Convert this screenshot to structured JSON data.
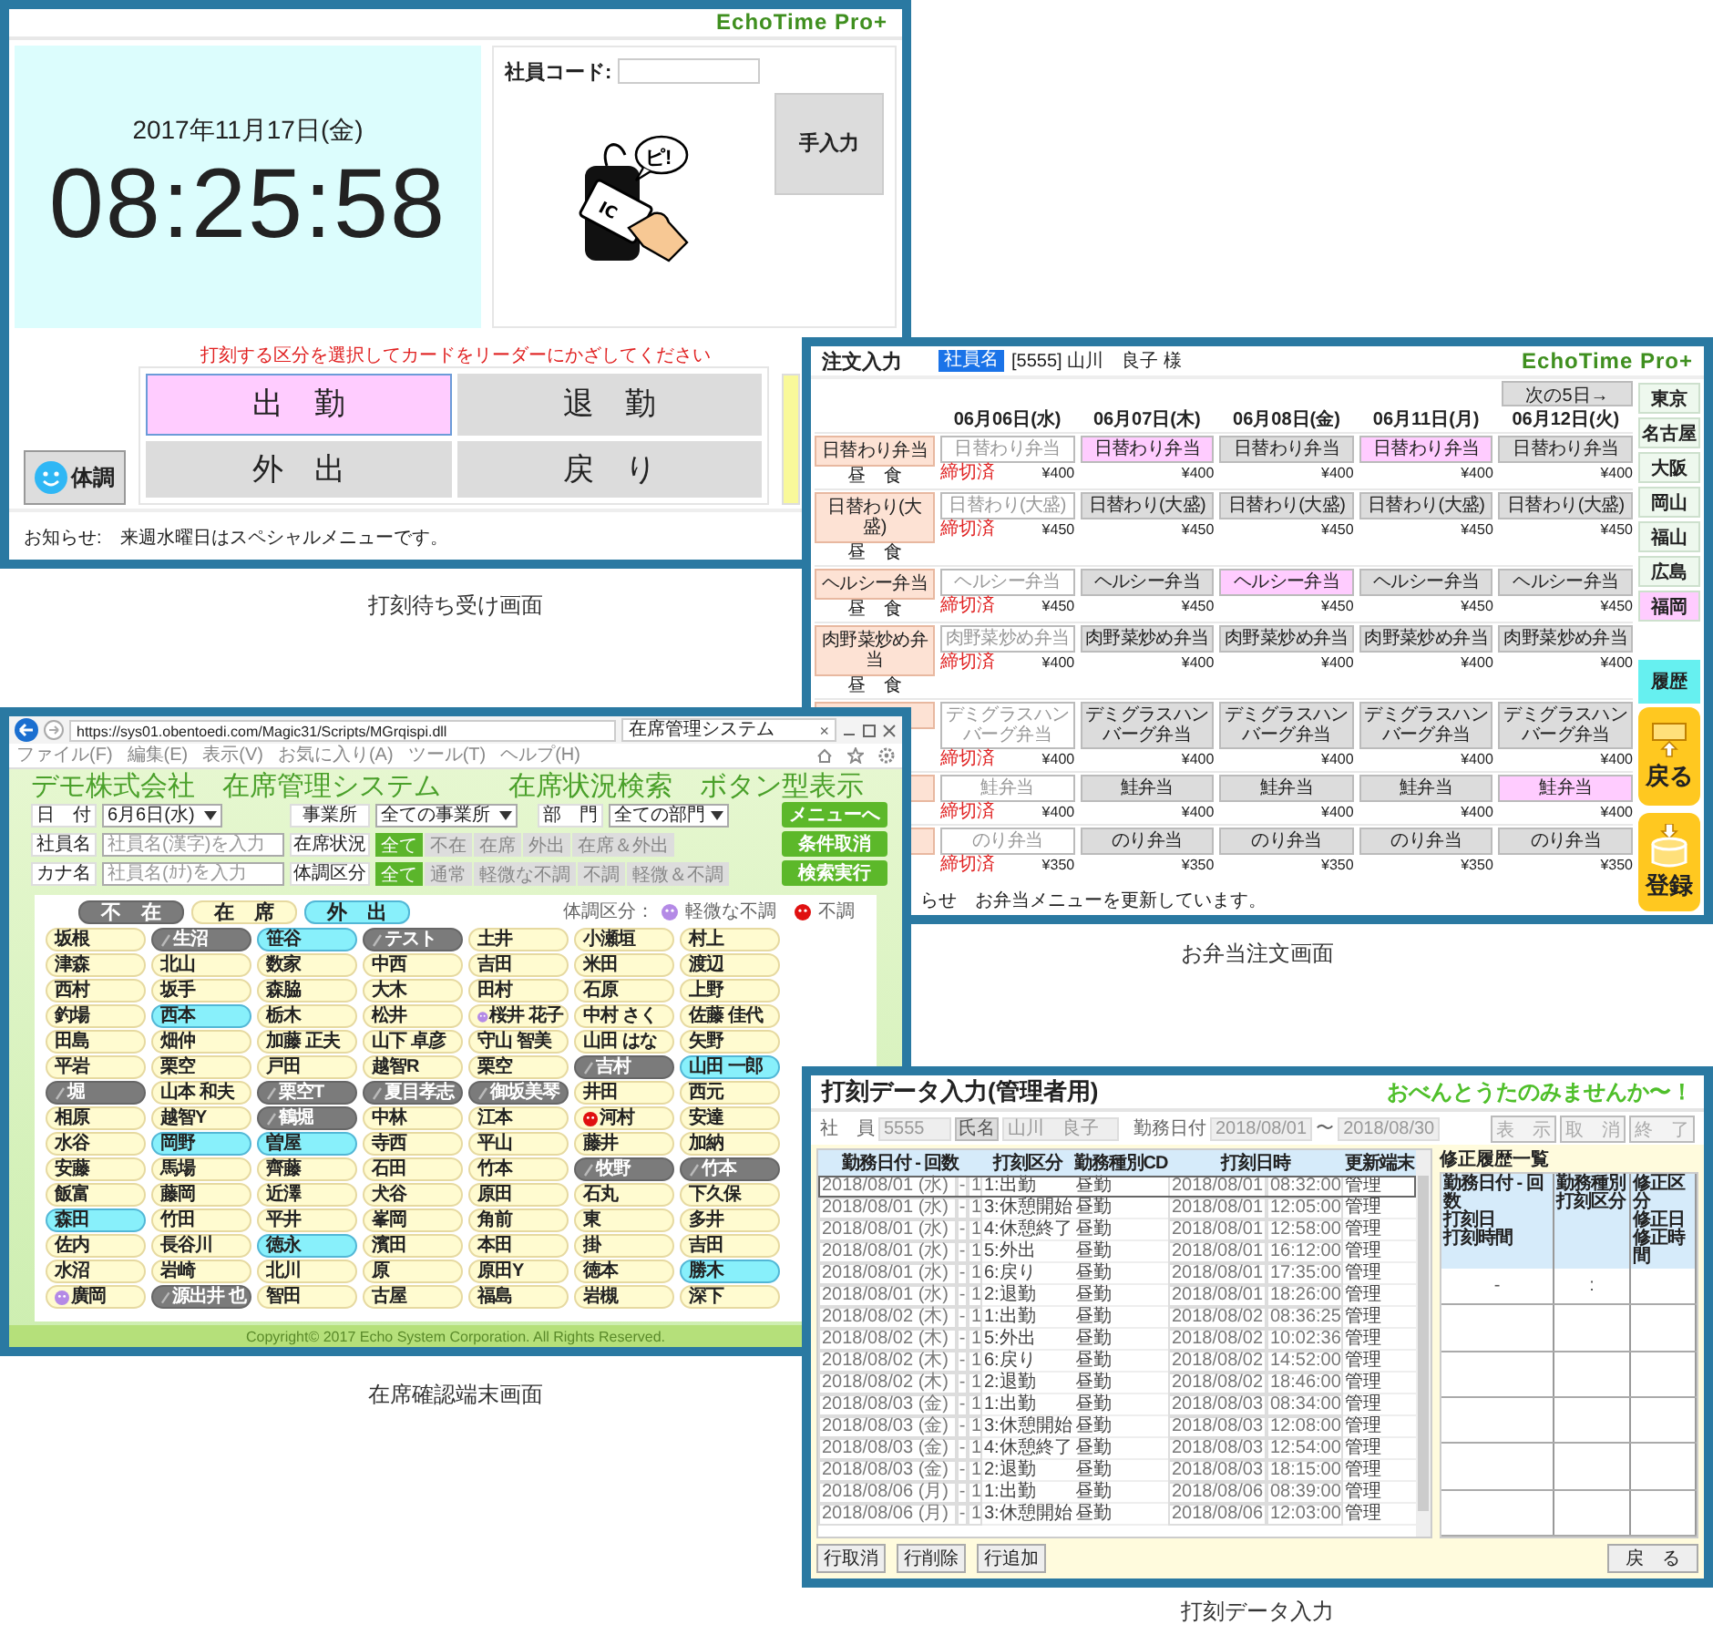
{
  "clock_screen": {
    "logo": "EchoTime Pro+",
    "date": "2017年11月17日(金)",
    "time": "08:25:58",
    "code_label": "社員コード:",
    "card_text": "IC",
    "bubble_text": "ピ!",
    "manual_button": "手入力",
    "instruction": "打刻する区分を選択してカードをリーダーにかざしてください",
    "punch_buttons": [
      {
        "label": "出　勤",
        "selected": true
      },
      {
        "label": "退　勤",
        "selected": false
      },
      {
        "label": "外　出",
        "selected": false
      },
      {
        "label": "戻　り",
        "selected": false
      }
    ],
    "health_button": "体調",
    "notice": "お知らせ:　来週水曜日はスペシャルメニューです。",
    "caption": "打刻待ち受け画面"
  },
  "order_screen": {
    "title": "注文入力",
    "user_badge": "社員名",
    "user_name": "[5555] 山川　良子 様",
    "logo": "EchoTime Pro+",
    "next_button": "次の5日→",
    "dates": [
      "06月06日(水)",
      "06月07日(木)",
      "06月08日(金)",
      "06月11日(月)",
      "06月12日(火)"
    ],
    "menus": [
      {
        "label": "日替わり弁当",
        "meal": "昼　食",
        "cells": [
          {
            "label": "日替わり弁当",
            "price": "¥400",
            "closed": true,
            "selected": false,
            "note": "締切済"
          },
          {
            "label": "日替わり弁当",
            "price": "¥400",
            "closed": false,
            "selected": true
          },
          {
            "label": "日替わり弁当",
            "price": "¥400",
            "closed": false,
            "selected": false
          },
          {
            "label": "日替わり弁当",
            "price": "¥400",
            "closed": false,
            "selected": true
          },
          {
            "label": "日替わり弁当",
            "price": "¥400",
            "closed": false,
            "selected": false
          }
        ]
      },
      {
        "label": "日替わり(大盛)",
        "meal": "昼　食",
        "cells": [
          {
            "label": "日替わり(大盛)",
            "price": "¥450",
            "closed": true,
            "selected": false,
            "note": "締切済"
          },
          {
            "label": "日替わり(大盛)",
            "price": "¥450",
            "closed": false,
            "selected": false
          },
          {
            "label": "日替わり(大盛)",
            "price": "¥450",
            "closed": false,
            "selected": false
          },
          {
            "label": "日替わり(大盛)",
            "price": "¥450",
            "closed": false,
            "selected": false
          },
          {
            "label": "日替わり(大盛)",
            "price": "¥450",
            "closed": false,
            "selected": false
          }
        ]
      },
      {
        "label": "ヘルシー弁当",
        "meal": "昼　食",
        "cells": [
          {
            "label": "ヘルシー弁当",
            "price": "¥450",
            "closed": true,
            "selected": false,
            "note": "締切済"
          },
          {
            "label": "ヘルシー弁当",
            "price": "¥450",
            "closed": false,
            "selected": false
          },
          {
            "label": "ヘルシー弁当",
            "price": "¥450",
            "closed": false,
            "selected": true
          },
          {
            "label": "ヘルシー弁当",
            "price": "¥450",
            "closed": false,
            "selected": false
          },
          {
            "label": "ヘルシー弁当",
            "price": "¥450",
            "closed": false,
            "selected": false
          }
        ]
      },
      {
        "label": "肉野菜炒め弁当",
        "meal": "昼　食",
        "cells": [
          {
            "label": "肉野菜炒め弁当",
            "price": "¥400",
            "closed": true,
            "selected": false,
            "note": "締切済"
          },
          {
            "label": "肉野菜炒め弁当",
            "price": "¥400",
            "closed": false,
            "selected": false
          },
          {
            "label": "肉野菜炒め弁当",
            "price": "¥400",
            "closed": false,
            "selected": false
          },
          {
            "label": "肉野菜炒め弁当",
            "price": "¥400",
            "closed": false,
            "selected": false
          },
          {
            "label": "肉野菜炒め弁当",
            "price": "¥400",
            "closed": false,
            "selected": false
          }
        ]
      },
      {
        "cells": [
          {
            "label": "デミグラスハンバーグ弁当",
            "price": "¥400",
            "closed": true,
            "selected": false,
            "note": "締切済"
          },
          {
            "label": "デミグラスハンバーグ弁当",
            "price": "¥400",
            "closed": false,
            "selected": false
          },
          {
            "label": "デミグラスハンバーグ弁当",
            "price": "¥400",
            "closed": false,
            "selected": false
          },
          {
            "label": "デミグラスハンバーグ弁当",
            "price": "¥400",
            "closed": false,
            "selected": false
          },
          {
            "label": "デミグラスハンバーグ弁当",
            "price": "¥400",
            "closed": false,
            "selected": false
          }
        ]
      },
      {
        "cells": [
          {
            "label": "鮭弁当",
            "price": "¥400",
            "closed": true,
            "selected": false,
            "note": "締切済"
          },
          {
            "label": "鮭弁当",
            "price": "¥400",
            "closed": false,
            "selected": false
          },
          {
            "label": "鮭弁当",
            "price": "¥400",
            "closed": false,
            "selected": false
          },
          {
            "label": "鮭弁当",
            "price": "¥400",
            "closed": false,
            "selected": false
          },
          {
            "label": "鮭弁当",
            "price": "¥400",
            "closed": false,
            "selected": true
          }
        ]
      },
      {
        "cells": [
          {
            "label": "のり弁当",
            "price": "¥350",
            "closed": true,
            "selected": false,
            "note": "締切済"
          },
          {
            "label": "のり弁当",
            "price": "¥350",
            "closed": false,
            "selected": false
          },
          {
            "label": "のり弁当",
            "price": "¥350",
            "closed": false,
            "selected": false
          },
          {
            "label": "のり弁当",
            "price": "¥350",
            "closed": false,
            "selected": false
          },
          {
            "label": "のり弁当",
            "price": "¥350",
            "closed": false,
            "selected": false
          }
        ]
      }
    ],
    "regions": [
      {
        "label": "東京",
        "selected": false
      },
      {
        "label": "名古屋",
        "selected": false
      },
      {
        "label": "大阪",
        "selected": false
      },
      {
        "label": "岡山",
        "selected": false
      },
      {
        "label": "福山",
        "selected": false
      },
      {
        "label": "広島",
        "selected": false
      },
      {
        "label": "福岡",
        "selected": true
      }
    ],
    "history_button": "履歴",
    "back_button": "戻る",
    "register_button": "登録",
    "notice": "らせ　お弁当メニューを更新しています。",
    "caption": "お弁当注文画面"
  },
  "presence_screen": {
    "browser": {
      "url": "https://sys01.obentoedi.com/Magic31/Scripts/MGrqispi.dll",
      "tab_title": "在席管理システム",
      "tab_close": "×",
      "menu": [
        "ファイル(F)",
        "編集(E)",
        "表示(V)",
        "お気に入り(A)",
        "ツール(T)",
        "ヘルプ(H)"
      ]
    },
    "title": "デモ株式会社　在席管理システム",
    "subtitle": "在席状況検索　ボタン型表示",
    "date_label": "日　付",
    "date_value": "6月6日(水)",
    "office_label": "事業所",
    "office_value": "全ての事業所",
    "dept_label": "部　門",
    "dept_value": "全ての部門",
    "name_label": "社員名",
    "name_placeholder": "社員名(漢字)を入力",
    "kana_label": "カナ名",
    "kana_placeholder": "社員名(ｶﾅ)を入力",
    "status_label": "在席状況",
    "status_options": [
      {
        "label": "全て",
        "selected": true
      },
      {
        "label": "不在",
        "selected": false
      },
      {
        "label": "在席",
        "selected": false
      },
      {
        "label": "外出",
        "selected": false
      },
      {
        "label": "在席＆外出",
        "selected": false
      }
    ],
    "health_label": "体調区分",
    "health_options": [
      {
        "label": "全て",
        "selected": true
      },
      {
        "label": "通常",
        "selected": false
      },
      {
        "label": "軽微な不調",
        "selected": false
      },
      {
        "label": "不調",
        "selected": false
      },
      {
        "label": "軽微＆不調",
        "selected": false
      }
    ],
    "buttons": [
      "メニューへ",
      "条件取消",
      "検索実行"
    ],
    "legend_tabs": [
      {
        "label": "不　在",
        "kind": "absent"
      },
      {
        "label": "在　席",
        "kind": "present"
      },
      {
        "label": "外　出",
        "kind": "out"
      }
    ],
    "health_legend_label": "体調区分：",
    "health_legend": [
      {
        "label": "軽微な不調",
        "color": "#b48ae6"
      },
      {
        "label": "不調",
        "color": "#e01010"
      }
    ],
    "people": [
      {
        "name": "坂根",
        "kind": "present"
      },
      {
        "name": "生沼",
        "kind": "absent"
      },
      {
        "name": "笹谷",
        "kind": "out"
      },
      {
        "name": "テスト",
        "kind": "absent"
      },
      {
        "name": "土井",
        "kind": "present"
      },
      {
        "name": "小瀬垣",
        "kind": "present"
      },
      {
        "name": "村上",
        "kind": "present"
      },
      {
        "name": "津森",
        "kind": "present"
      },
      {
        "name": "北山",
        "kind": "present"
      },
      {
        "name": "数家",
        "kind": "present"
      },
      {
        "name": "中西",
        "kind": "present"
      },
      {
        "name": "吉田",
        "kind": "present"
      },
      {
        "name": "米田",
        "kind": "present"
      },
      {
        "name": "渡辺",
        "kind": "present"
      },
      {
        "name": "西村",
        "kind": "present"
      },
      {
        "name": "坂手",
        "kind": "present"
      },
      {
        "name": "森脇",
        "kind": "present"
      },
      {
        "name": "大木",
        "kind": "present"
      },
      {
        "name": "田村",
        "kind": "present"
      },
      {
        "name": "石原",
        "kind": "present"
      },
      {
        "name": "上野",
        "kind": "present"
      },
      {
        "name": "釣場",
        "kind": "present"
      },
      {
        "name": "西本",
        "kind": "out"
      },
      {
        "name": "栃木",
        "kind": "present"
      },
      {
        "name": "松井",
        "kind": "present"
      },
      {
        "name": "桜井 花子",
        "kind": "present",
        "color": "#b48ae6"
      },
      {
        "name": "中村 さく",
        "kind": "present"
      },
      {
        "name": "佐藤 佳代",
        "kind": "present"
      },
      {
        "name": "田島",
        "kind": "present"
      },
      {
        "name": "畑仲",
        "kind": "present"
      },
      {
        "name": "加藤 正夫",
        "kind": "present"
      },
      {
        "name": "山下 卓彦",
        "kind": "present"
      },
      {
        "name": "守山 智美",
        "kind": "present"
      },
      {
        "name": "山田 はな",
        "kind": "present"
      },
      {
        "name": "矢野",
        "kind": "present"
      },
      {
        "name": "平岩",
        "kind": "present"
      },
      {
        "name": "栗空",
        "kind": "present"
      },
      {
        "name": "戸田",
        "kind": "present"
      },
      {
        "name": "越智R",
        "kind": "present"
      },
      {
        "name": "栗空",
        "kind": "present"
      },
      {
        "name": "吉村",
        "kind": "absent"
      },
      {
        "name": "山田 一郎",
        "kind": "out"
      },
      {
        "name": "堀",
        "kind": "absent"
      },
      {
        "name": "山本 和夫",
        "kind": "present"
      },
      {
        "name": "栗空T",
        "kind": "absent"
      },
      {
        "name": "夏目孝志",
        "kind": "absent"
      },
      {
        "name": "御坂美琴",
        "kind": "absent"
      },
      {
        "name": "井田",
        "kind": "present"
      },
      {
        "name": "西元",
        "kind": "present"
      },
      {
        "name": "相原",
        "kind": "present"
      },
      {
        "name": "越智Y",
        "kind": "present"
      },
      {
        "name": "鶴堀",
        "kind": "absent"
      },
      {
        "name": "中林",
        "kind": "present"
      },
      {
        "name": "江本",
        "kind": "present"
      },
      {
        "name": "河村",
        "kind": "present",
        "color": "#e01010"
      },
      {
        "name": "安達",
        "kind": "present"
      },
      {
        "name": "水谷",
        "kind": "present"
      },
      {
        "name": "岡野",
        "kind": "out"
      },
      {
        "name": "曽屋",
        "kind": "out"
      },
      {
        "name": "寺西",
        "kind": "present"
      },
      {
        "name": "平山",
        "kind": "present"
      },
      {
        "name": "藤井",
        "kind": "present"
      },
      {
        "name": "加納",
        "kind": "present"
      },
      {
        "name": "安藤",
        "kind": "present"
      },
      {
        "name": "馬場",
        "kind": "present"
      },
      {
        "name": "齊藤",
        "kind": "present"
      },
      {
        "name": "石田",
        "kind": "present"
      },
      {
        "name": "竹本",
        "kind": "present"
      },
      {
        "name": "牧野",
        "kind": "absent"
      },
      {
        "name": "竹本",
        "kind": "absent"
      },
      {
        "name": "飯富",
        "kind": "present"
      },
      {
        "name": "藤岡",
        "kind": "present"
      },
      {
        "name": "近澤",
        "kind": "present"
      },
      {
        "name": "犬谷",
        "kind": "present"
      },
      {
        "name": "原田",
        "kind": "present"
      },
      {
        "name": "石丸",
        "kind": "present"
      },
      {
        "name": "下久保",
        "kind": "present"
      },
      {
        "name": "森田",
        "kind": "out"
      },
      {
        "name": "竹田",
        "kind": "present"
      },
      {
        "name": "平井",
        "kind": "present"
      },
      {
        "name": "峯岡",
        "kind": "present"
      },
      {
        "name": "角前",
        "kind": "present"
      },
      {
        "name": "東",
        "kind": "present"
      },
      {
        "name": "多井",
        "kind": "present"
      },
      {
        "name": "佐内",
        "kind": "present"
      },
      {
        "name": "長谷川",
        "kind": "present"
      },
      {
        "name": "徳永",
        "kind": "out"
      },
      {
        "name": "濱田",
        "kind": "present"
      },
      {
        "name": "本田",
        "kind": "present"
      },
      {
        "name": "掛",
        "kind": "present"
      },
      {
        "name": "吉田",
        "kind": "present"
      },
      {
        "name": "水沼",
        "kind": "present"
      },
      {
        "name": "岩崎",
        "kind": "present"
      },
      {
        "name": "北川",
        "kind": "present"
      },
      {
        "name": "原",
        "kind": "present"
      },
      {
        "name": "原田Y",
        "kind": "present"
      },
      {
        "name": "徳本",
        "kind": "present"
      },
      {
        "name": "勝木",
        "kind": "out"
      },
      {
        "name": "廣岡",
        "kind": "present",
        "color": "#b48ae6"
      },
      {
        "name": "源出井 也",
        "kind": "absent"
      },
      {
        "name": "智田",
        "kind": "present"
      },
      {
        "name": "古屋",
        "kind": "present"
      },
      {
        "name": "福島",
        "kind": "present"
      },
      {
        "name": "岩槻",
        "kind": "present"
      },
      {
        "name": "深下",
        "kind": "present"
      }
    ],
    "copyright": "Copyright© 2017 Echo System Corporation. All Rights Reserved.",
    "caption": "在席確認端末画面"
  },
  "entry_screen": {
    "title": "打刻データ入力(管理者用)",
    "slogan": "おべんとうたのみませんか〜！",
    "employee_label": "社　員",
    "employee_value": "5555",
    "name_badge": "氏名",
    "name_value": "山川　良子",
    "date_label": "勤務日付",
    "date_from": "2018/08/01",
    "date_sep": "〜",
    "date_to": "2018/08/30",
    "buttons": [
      {
        "label": "表　示",
        "disabled": true
      },
      {
        "label": "取　消",
        "disabled": true
      },
      {
        "label": "終　了",
        "disabled": true
      }
    ],
    "columns": [
      "勤務日付 - 回数",
      "打刻区分",
      "勤務種別CD",
      "打刻日時",
      "更新端末"
    ],
    "rows": [
      {
        "date": "2018/08/01 (水)",
        "sep": "-",
        "count": "1",
        "type": "1:出勤",
        "shift": "昼勤",
        "day": "2018/08/01",
        "time": "08:32:00",
        "terminal": "管理",
        "selected": true
      },
      {
        "date": "2018/08/01 (水)",
        "sep": "-",
        "count": "1",
        "type": "3:休憩開始",
        "shift": "昼勤",
        "day": "2018/08/01",
        "time": "12:05:00",
        "terminal": "管理",
        "selected": false
      },
      {
        "date": "2018/08/01 (水)",
        "sep": "-",
        "count": "1",
        "type": "4:休憩終了",
        "shift": "昼勤",
        "day": "2018/08/01",
        "time": "12:58:00",
        "terminal": "管理",
        "selected": false
      },
      {
        "date": "2018/08/01 (水)",
        "sep": "-",
        "count": "1",
        "type": "5:外出",
        "shift": "昼勤",
        "day": "2018/08/01",
        "time": "16:12:00",
        "terminal": "管理",
        "selected": false
      },
      {
        "date": "2018/08/01 (水)",
        "sep": "-",
        "count": "1",
        "type": "6:戻り",
        "shift": "昼勤",
        "day": "2018/08/01",
        "time": "17:35:00",
        "terminal": "管理",
        "selected": false
      },
      {
        "date": "2018/08/01 (水)",
        "sep": "-",
        "count": "1",
        "type": "2:退勤",
        "shift": "昼勤",
        "day": "2018/08/01",
        "time": "18:26:00",
        "terminal": "管理",
        "selected": false
      },
      {
        "date": "2018/08/02 (木)",
        "sep": "-",
        "count": "1",
        "type": "1:出勤",
        "shift": "昼勤",
        "day": "2018/08/02",
        "time": "08:36:25",
        "terminal": "管理",
        "selected": false
      },
      {
        "date": "2018/08/02 (木)",
        "sep": "-",
        "count": "1",
        "type": "5:外出",
        "shift": "昼勤",
        "day": "2018/08/02",
        "time": "10:02:36",
        "terminal": "管理",
        "selected": false
      },
      {
        "date": "2018/08/02 (木)",
        "sep": "-",
        "count": "1",
        "type": "6:戻り",
        "shift": "昼勤",
        "day": "2018/08/02",
        "time": "14:52:00",
        "terminal": "管理",
        "selected": false
      },
      {
        "date": "2018/08/02 (木)",
        "sep": "-",
        "count": "1",
        "type": "2:退勤",
        "shift": "昼勤",
        "day": "2018/08/02",
        "time": "18:46:00",
        "terminal": "管理",
        "selected": false
      },
      {
        "date": "2018/08/03 (金)",
        "sep": "-",
        "count": "1",
        "type": "1:出勤",
        "shift": "昼勤",
        "day": "2018/08/03",
        "time": "08:34:00",
        "terminal": "管理",
        "selected": false
      },
      {
        "date": "2018/08/03 (金)",
        "sep": "-",
        "count": "1",
        "type": "3:休憩開始",
        "shift": "昼勤",
        "day": "2018/08/03",
        "time": "12:08:00",
        "terminal": "管理",
        "selected": false
      },
      {
        "date": "2018/08/03 (金)",
        "sep": "-",
        "count": "1",
        "type": "4:休憩終了",
        "shift": "昼勤",
        "day": "2018/08/03",
        "time": "12:54:00",
        "terminal": "管理",
        "selected": false
      },
      {
        "date": "2018/08/03 (金)",
        "sep": "-",
        "count": "1",
        "type": "2:退勤",
        "shift": "昼勤",
        "day": "2018/08/03",
        "time": "18:15:00",
        "terminal": "管理",
        "selected": false
      },
      {
        "date": "2018/08/06 (月)",
        "sep": "-",
        "count": "1",
        "type": "1:出勤",
        "shift": "昼勤",
        "day": "2018/08/06",
        "time": "08:39:00",
        "terminal": "管理",
        "selected": false
      },
      {
        "date": "2018/08/06 (月)",
        "sep": "-",
        "count": "1",
        "type": "3:休憩開始",
        "shift": "昼勤",
        "day": "2018/08/06",
        "time": "12:03:00",
        "terminal": "管理",
        "selected": false
      }
    ],
    "history_title": "修正履歴一覧",
    "history_columns": [
      [
        "勤務日付 - 回数",
        "打刻日",
        "打刻時間"
      ],
      [
        "勤務種別",
        "打刻区分"
      ],
      [
        "修正区分",
        "修正日",
        "修正時間"
      ]
    ],
    "history_marks": [
      "-",
      ":"
    ],
    "row_buttons": [
      "行取消",
      "行削除",
      "行追加"
    ],
    "back_button": "戻　る",
    "caption": "打刻データ入力"
  }
}
